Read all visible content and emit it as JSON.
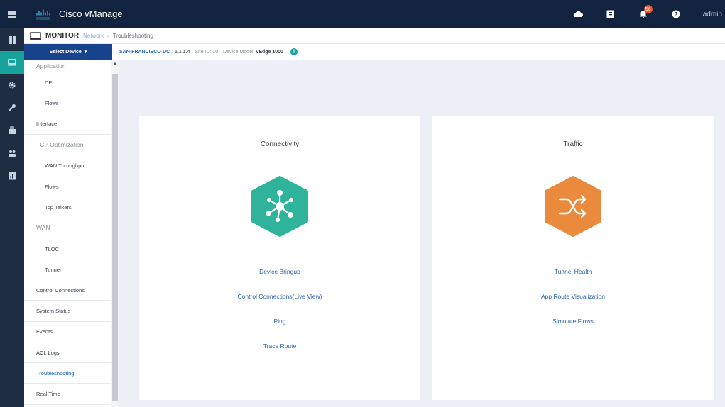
{
  "header": {
    "app_title": "Cisco vManage",
    "alarm_count": "56",
    "user": "admin"
  },
  "breadcrumb": {
    "section": "MONITOR",
    "parent": "Network",
    "current": "Troubleshooting"
  },
  "device_bar": {
    "select_label": "Select Device",
    "device_name": "SAN-FRANCISCO-DC",
    "system_ip": "1.1.1.4",
    "site_label": "Site ID: 10",
    "model_label": "Device Model:",
    "model_value": "vEdge 1000"
  },
  "side_menu": {
    "items": [
      {
        "label": "Application",
        "kind": "group"
      },
      {
        "label": "DPI",
        "kind": "sub"
      },
      {
        "label": "Flows",
        "kind": "sub"
      },
      {
        "label": "Interface",
        "kind": "item"
      },
      {
        "label": "TCP Optimization",
        "kind": "group"
      },
      {
        "label": "WAN Throughput",
        "kind": "sub"
      },
      {
        "label": "Flows",
        "kind": "sub"
      },
      {
        "label": "Top Talkers",
        "kind": "sub"
      },
      {
        "label": "WAN",
        "kind": "group"
      },
      {
        "label": "TLOC",
        "kind": "sub"
      },
      {
        "label": "Tunnel",
        "kind": "sub"
      },
      {
        "label": "Control Connections",
        "kind": "item"
      },
      {
        "label": "System Status",
        "kind": "item"
      },
      {
        "label": "Events",
        "kind": "item"
      },
      {
        "label": "ACL Logs",
        "kind": "item"
      },
      {
        "label": "Troubleshooting",
        "kind": "selected"
      },
      {
        "label": "Real Time",
        "kind": "item"
      }
    ]
  },
  "cards": {
    "connectivity": {
      "title": "Connectivity",
      "icon": "network-hub-icon",
      "color": "#2fb39a",
      "links": [
        "Device Bringup",
        "Control Connections(Live View)",
        "Ping",
        "Trace Route"
      ]
    },
    "traffic": {
      "title": "Traffic",
      "icon": "shuffle-arrows-icon",
      "color": "#e98a3d",
      "links": [
        "Tunnel Health",
        "App Route Visualization",
        "Simulate Flows"
      ]
    }
  },
  "colors": {
    "topbar": "#12233f",
    "rail": "#1f2d43",
    "accent": "#17a39c",
    "select_device": "#17428c",
    "link": "#2a62a8"
  }
}
